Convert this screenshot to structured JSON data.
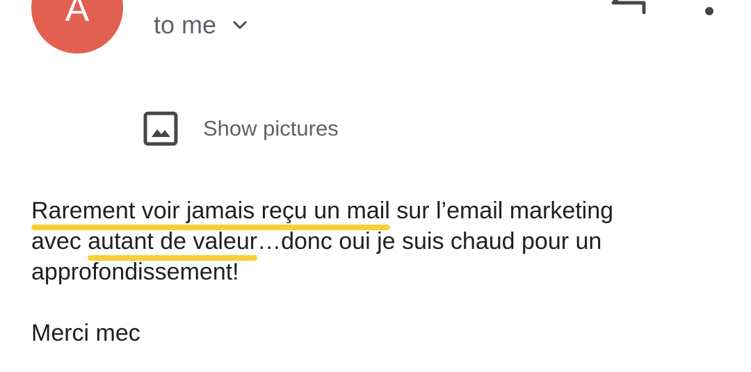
{
  "header": {
    "avatar_letter": "A",
    "avatar_color": "#e2604f",
    "recipient": "to me",
    "recipient_dropdown_icon": "chevron-down-icon",
    "reply_icon": "reply-icon",
    "more_icon": "more-vert-icon"
  },
  "show_pictures": {
    "icon": "image-icon",
    "label": "Show pictures"
  },
  "message": {
    "line1_highlight": "Rarement voir jamais reçu un mail",
    "line1_rest": " sur l’email marketing",
    "line2_start": "avec ",
    "line2_highlight": "autant de valeur",
    "line2_rest": "…donc oui je suis chaud pour un",
    "line3": "approfondissement!",
    "closing": "Merci mec",
    "highlight_color": "#f9cf35"
  }
}
